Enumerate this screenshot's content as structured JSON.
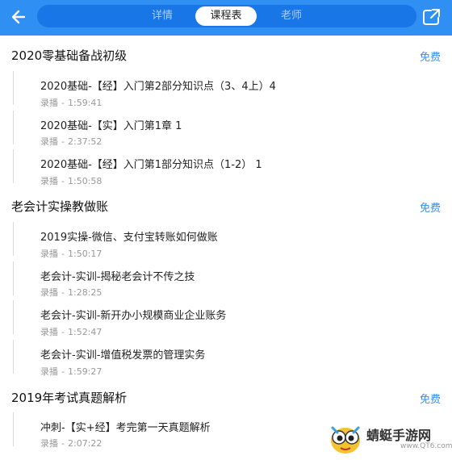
{
  "header": {
    "tabs": [
      "详情",
      "课程表",
      "老师"
    ],
    "active_tab": "课程表",
    "colors": {
      "accent": "#2f8ff3",
      "tab_bg": "#1876e6"
    }
  },
  "sections": [
    {
      "title": "2020零基础备战初级",
      "badge": "免费",
      "lessons": [
        {
          "title": "2020基础-【经】入门第2部分知识点（3、4上）4",
          "type": "录播",
          "sep": "-",
          "duration": "1:59:41"
        },
        {
          "title": "2020基础-【实】入门第1章 1",
          "type": "录播",
          "sep": "-",
          "duration": "2:37:52"
        },
        {
          "title": "2020基础-【经】入门第1部分知识点（1-2） 1",
          "type": "录播",
          "sep": "-",
          "duration": "1:50:58"
        }
      ]
    },
    {
      "title": "老会计实操教做账",
      "badge": "免费",
      "lessons": [
        {
          "title": "2019实操-微信、支付宝转账如何做账",
          "type": "录播",
          "sep": "-",
          "duration": "1:50:17"
        },
        {
          "title": "老会计-实训-揭秘老会计不传之技",
          "type": "录播",
          "sep": "-",
          "duration": "1:28:25"
        },
        {
          "title": "老会计-实训-新开办小规模商业企业账务",
          "type": "录播",
          "sep": "-",
          "duration": "1:52:47"
        },
        {
          "title": "老会计-实训-增值税发票的管理实务",
          "type": "录播",
          "sep": "-",
          "duration": "1:59:27"
        }
      ]
    },
    {
      "title": "2019年考试真题解析",
      "badge": "免费",
      "lessons": [
        {
          "title": "冲刺-【实+经】考完第一天真题解析",
          "type": "录播",
          "sep": "-",
          "duration": "2:07:22"
        }
      ]
    }
  ],
  "watermark": {
    "name": "蜻蜓手游网",
    "url": "www.QT6.com"
  }
}
